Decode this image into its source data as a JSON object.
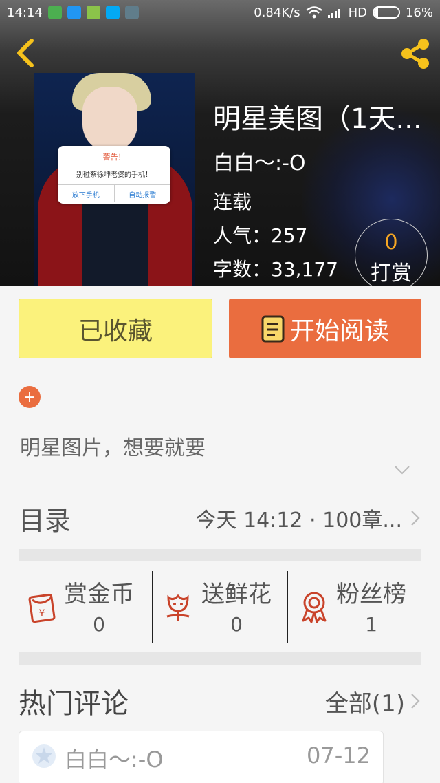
{
  "status_bar": {
    "time": "14:14",
    "speed": "0.84K/s",
    "network": "HD",
    "battery": "16%",
    "battery_level": 0.16,
    "app_icon_colors": [
      "#4caf50",
      "#2196f3",
      "#8bc34a",
      "#03a9f4",
      "#607d8b"
    ]
  },
  "header": {
    "back_icon": "chevron-left-icon",
    "share_icon": "share-icon",
    "accent_color": "#f6c21c"
  },
  "book": {
    "title": "明星美图（1天...",
    "author": "白白～:-O",
    "status": "连载",
    "popularity": "人气：257",
    "word_count": "字数：33,177",
    "cover": {
      "warn_title": "警告！",
      "warn_message": "别碰蔡徐坤老婆的手机！",
      "warn_btn_left": "放下手机",
      "warn_btn_right": "自动报警"
    }
  },
  "reward": {
    "count": "0",
    "label": "打赏"
  },
  "actions": {
    "collect_label": "已收藏",
    "read_label": "开始阅读",
    "collect_color": "#fbf27c",
    "read_color": "#ea6d3f"
  },
  "tags": {
    "add_symbol": "+"
  },
  "description": "明星图片，想要就要",
  "toc": {
    "label": "目录",
    "info": "今天 14:12 · 100章..."
  },
  "stats": [
    {
      "label": "赏金币",
      "value": "0",
      "icon": "red-envelope-icon"
    },
    {
      "label": "送鲜花",
      "value": "0",
      "icon": "flower-icon"
    },
    {
      "label": "粉丝榜",
      "value": "1",
      "icon": "medal-icon"
    }
  ],
  "comments": {
    "title": "热门评论",
    "all_label": "全部(1)",
    "items": [
      {
        "user": "白白～:-O",
        "date": "07-12"
      }
    ]
  }
}
